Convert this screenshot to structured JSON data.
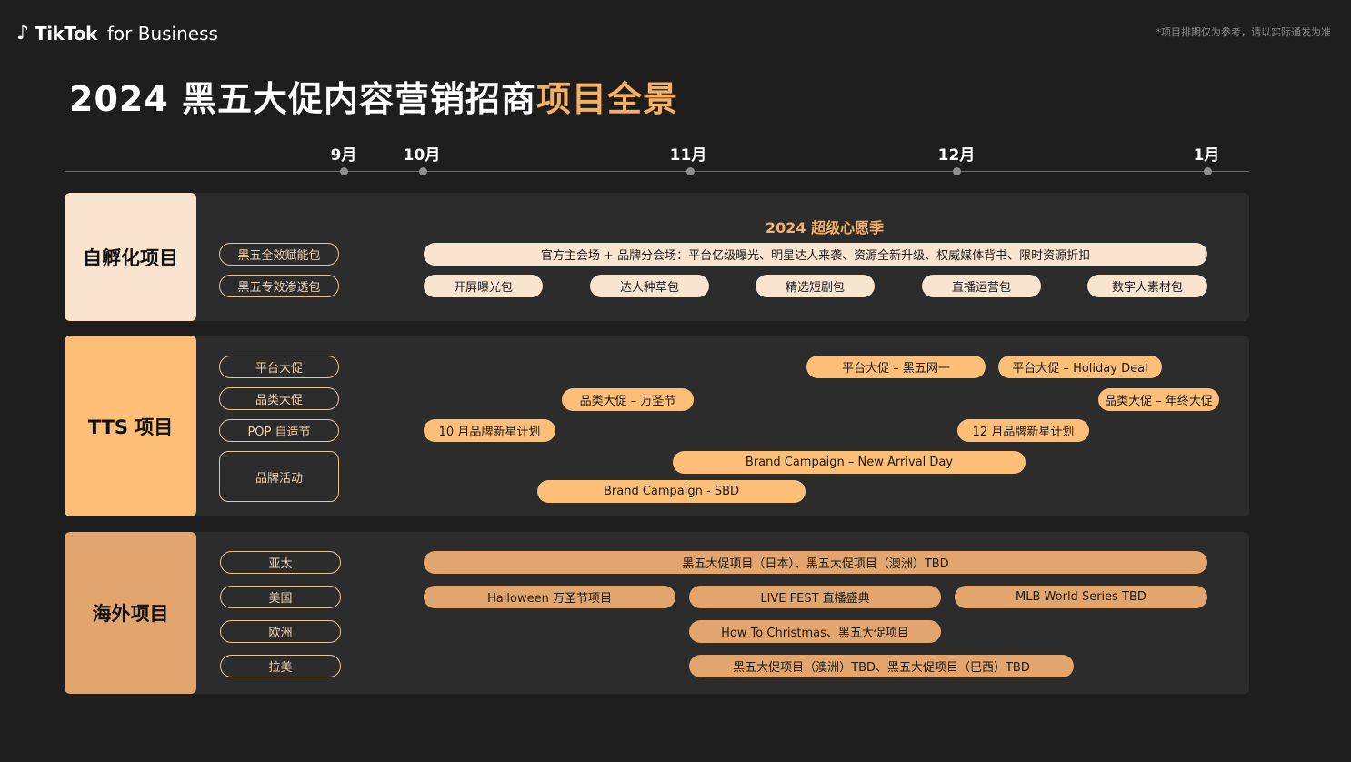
{
  "header": {
    "logo_glyph": "♪",
    "logo_brand": "TikTok",
    "logo_suffix": "for Business",
    "disclaimer": "*项目排期仅为参考，请以实际通发为准",
    "title_main": "2024 黑五大促内容营销招商",
    "title_highlight": "项目全景"
  },
  "timeline": {
    "months": [
      "9月",
      "10月",
      "11月",
      "12月",
      "1月"
    ]
  },
  "sections": {
    "incubation": {
      "label": "自孵化项目",
      "packs": [
        "黑五全效赋能包",
        "黑五专效渗透包"
      ],
      "season_title": "2024 超级心愿季",
      "main_bar": "官方主会场 + 品牌分会场：平台亿级曝光、明星达人来袭、资源全新升级、权威媒体背书、限时资源折扣",
      "sub_packs": [
        "开屏曝光包",
        "达人种草包",
        "精选短剧包",
        "直播运营包",
        "数字人素材包"
      ]
    },
    "tts": {
      "label": "TTS 项目",
      "rows": [
        "平台大促",
        "品类大促",
        "POP 自造节",
        "品牌活动"
      ],
      "bars": {
        "platform_bf": "平台大促 – 黑五网一",
        "platform_holiday": "平台大促 – Holiday Deal",
        "category_halloween": "品类大促 – 万圣节",
        "category_yearend": "品类大促 – 年终大促",
        "pop_oct": "10 月品牌新星计划",
        "pop_dec": "12 月品牌新星计划",
        "brand_new_arrival": "Brand Campaign – New Arrival Day",
        "brand_sbd": "Brand Campaign - SBD"
      }
    },
    "overseas": {
      "label": "海外项目",
      "rows": [
        "亚太",
        "美国",
        "欧洲",
        "拉美"
      ],
      "bars": {
        "apac": "黑五大促项目（日本）、黑五大促项目（澳洲）TBD",
        "us_halloween": "Halloween 万圣节项目",
        "us_livefest": "LIVE FEST 直播盛典",
        "us_mlb": "MLB World Series TBD",
        "eu": "How To Christmas、黑五大促项目",
        "latam": "黑五大促项目（澳洲）TBD、黑五大促项目（巴西）TBD"
      }
    }
  }
}
